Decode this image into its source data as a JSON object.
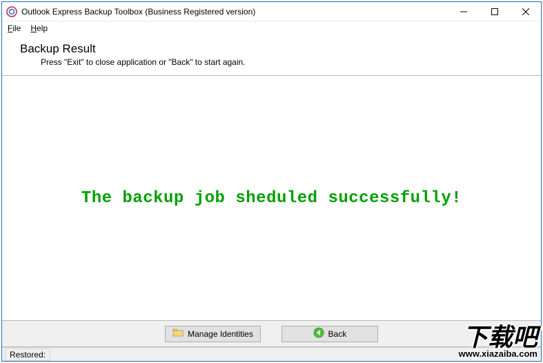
{
  "titlebar": {
    "title": "Outlook Express Backup Toolbox (Business Registered version)"
  },
  "menubar": {
    "file": {
      "label": "File",
      "accel": "F"
    },
    "help": {
      "label": "Help",
      "accel": "H"
    }
  },
  "header": {
    "title": "Backup Result",
    "subtitle": "Press \"Exit\" to close application or \"Back\" to start again."
  },
  "main": {
    "success_message": "The backup job sheduled successfully!"
  },
  "buttons": {
    "manage_identities": "Manage Identities",
    "back": "Back"
  },
  "statusbar": {
    "restored_label": "Restored:"
  },
  "watermark": {
    "big": "下载吧",
    "small": "www.xiazaiba.com"
  }
}
